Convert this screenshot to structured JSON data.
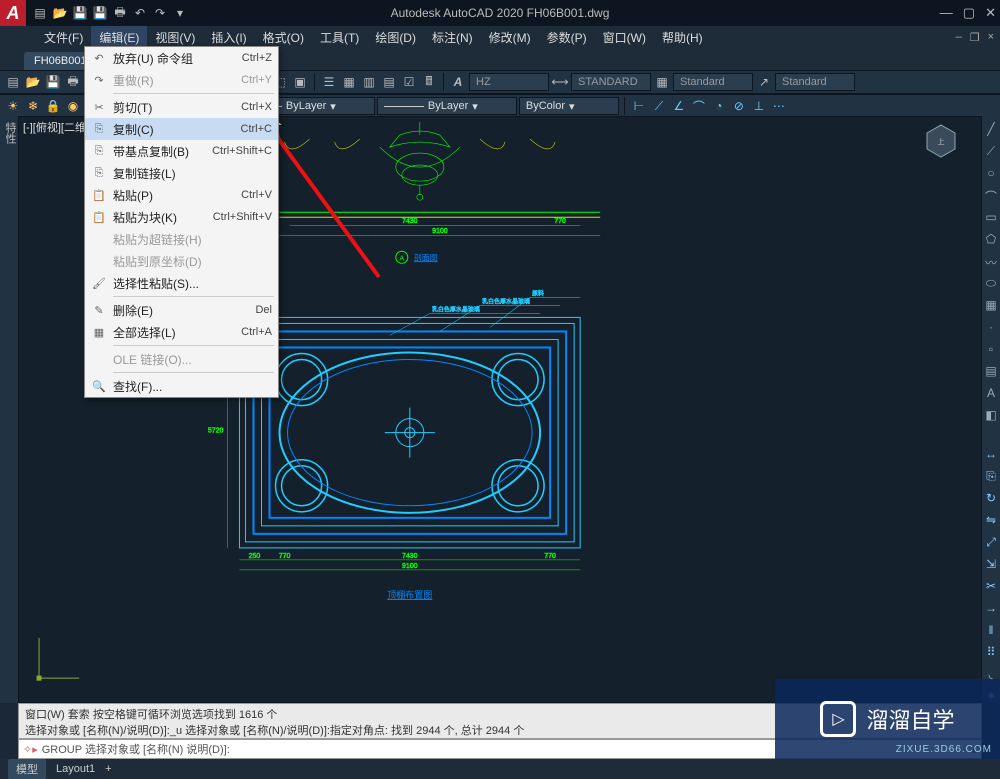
{
  "title": "Autodesk AutoCAD 2020   FH06B001.dwg",
  "menubar": [
    "文件(F)",
    "编辑(E)",
    "视图(V)",
    "插入(I)",
    "格式(O)",
    "工具(T)",
    "绘图(D)",
    "标注(N)",
    "修改(M)",
    "参数(P)",
    "窗口(W)",
    "帮助(H)"
  ],
  "active_menu_index": 1,
  "doc_tab": {
    "name": "FH06B001*",
    "layouts": [
      "模型",
      "Layout1"
    ]
  },
  "toolbar2": {
    "layer_name": "ByLayer",
    "linetype": "ByLayer",
    "lineweight": "ByLayer",
    "plotstyle": "ByColor",
    "textstyle": "HZ",
    "dimstyle": "STANDARD",
    "tablestyle": "Standard",
    "mleaderstyle": "Standard"
  },
  "viewport_label": "[-][俯视][二维",
  "dropdown": {
    "items": [
      {
        "icon": "↶",
        "label": "放弃(U) 命令组",
        "shortcut": "Ctrl+Z",
        "disabled": false
      },
      {
        "icon": "↷",
        "label": "重做(R)",
        "shortcut": "Ctrl+Y",
        "disabled": true
      },
      {
        "divider": true
      },
      {
        "icon": "✂",
        "label": "剪切(T)",
        "shortcut": "Ctrl+X"
      },
      {
        "icon": "⎘",
        "label": "复制(C)",
        "shortcut": "Ctrl+C",
        "highlight": true
      },
      {
        "icon": "⎘",
        "label": "带基点复制(B)",
        "shortcut": "Ctrl+Shift+C"
      },
      {
        "icon": "⎘",
        "label": "复制链接(L)"
      },
      {
        "icon": "📋",
        "label": "粘贴(P)",
        "shortcut": "Ctrl+V"
      },
      {
        "icon": "📋",
        "label": "粘贴为块(K)",
        "shortcut": "Ctrl+Shift+V"
      },
      {
        "icon": "",
        "label": "粘贴为超链接(H)",
        "disabled": true
      },
      {
        "icon": "",
        "label": "粘贴到原坐标(D)",
        "disabled": true
      },
      {
        "icon": "🖌",
        "label": "选择性粘贴(S)..."
      },
      {
        "divider": true
      },
      {
        "icon": "✎",
        "label": "删除(E)",
        "shortcut": "Del"
      },
      {
        "icon": "▦",
        "label": "全部选择(L)",
        "shortcut": "Ctrl+A"
      },
      {
        "divider": true
      },
      {
        "icon": "",
        "label": "OLE 链接(O)...",
        "disabled": true
      },
      {
        "divider": true
      },
      {
        "icon": "🔍",
        "label": "查找(F)..."
      }
    ]
  },
  "cmd_history": [
    "窗口(W) 套索  按空格键可循环浏览选项找到 1616 个",
    "选择对象或 [名称(N)/说明(D)]:_u 选择对象或 [名称(N)/说明(D)]:指定对角点: 找到 2944 个, 总计 2944 个"
  ],
  "cmd_prompt": "GROUP 选择对象或 [名称(N) 说明(D)]:",
  "cmd_icon": "▸",
  "drawing_labels": {
    "elev_title": "剖面图",
    "plan_title": "顶棚布置图",
    "dim1": "7430",
    "dim2": "770",
    "dim3": "9100",
    "dim4": "770",
    "dim5": "5720",
    "dim6": "250",
    "note1": "原料",
    "note2": "乳白色厚水晶玻璃",
    "note3": "乳白色厚水晶玻璃"
  },
  "watermark": {
    "brand": "溜溜自学",
    "url": "ZIXUE.3D66.COM"
  }
}
